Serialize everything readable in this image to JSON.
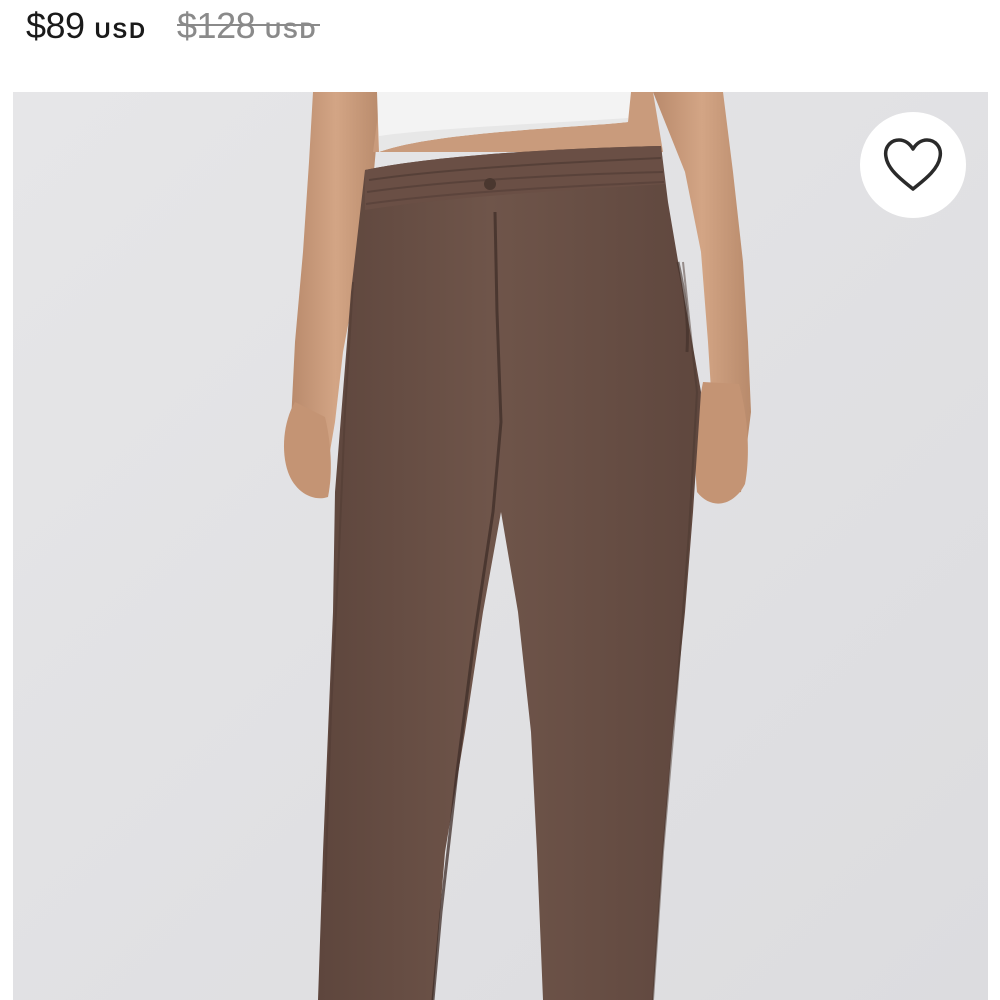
{
  "price": {
    "current": "$89",
    "current_currency": "USD",
    "original": "$128",
    "original_currency": "USD"
  },
  "product_image": {
    "subject": "brown jogger pants on model"
  },
  "wishlist": {
    "icon": "heart-outline-icon"
  },
  "colors": {
    "pants": "#6b5147",
    "background": "#e3e3e5",
    "top": "#f2f2f2",
    "skin": "#c89a7a"
  }
}
